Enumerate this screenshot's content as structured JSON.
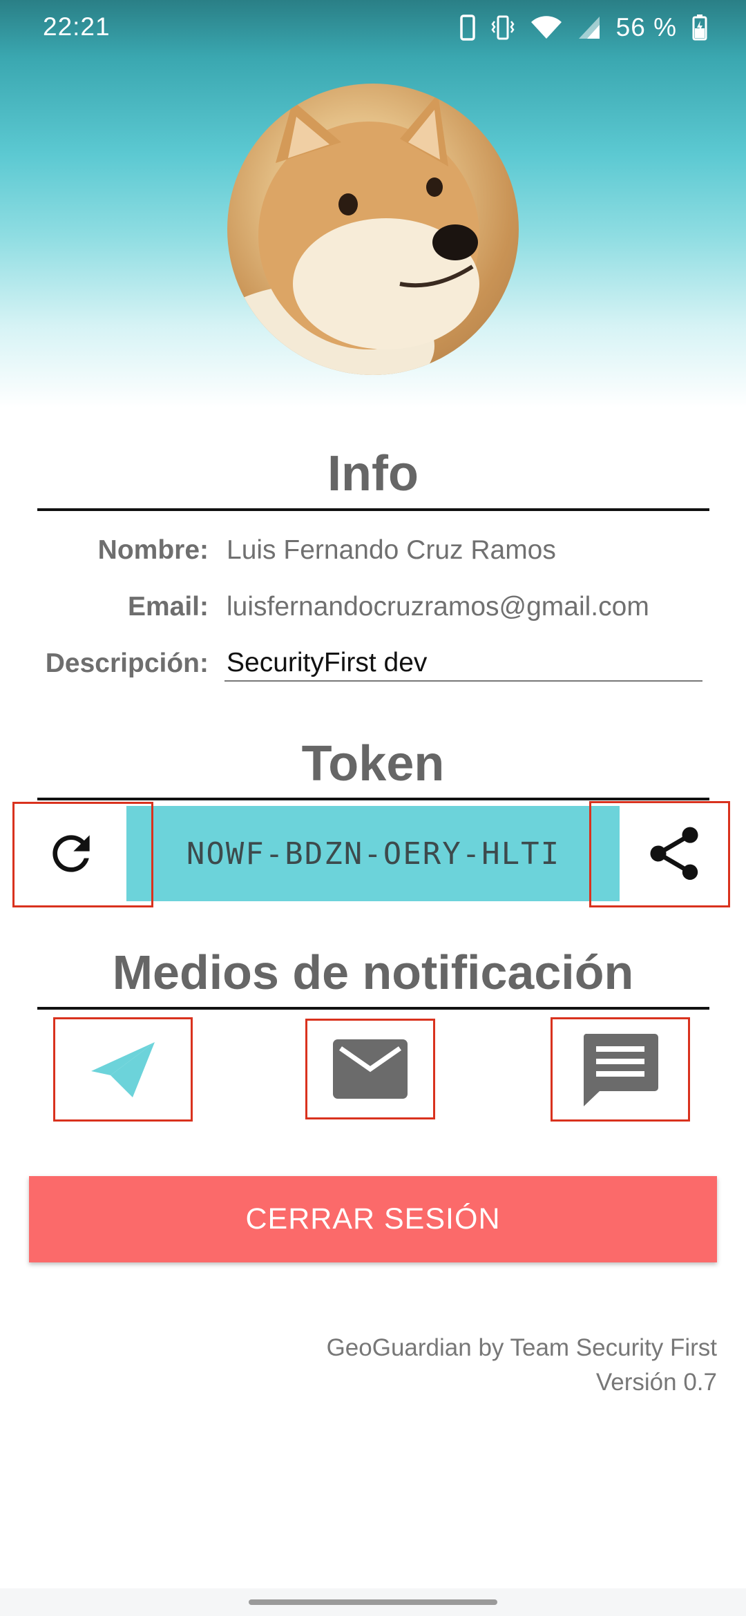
{
  "status_bar": {
    "time": "22:21",
    "battery_text": "56 %"
  },
  "profile": {
    "avatar_icon": "shiba-dog-avatar"
  },
  "info": {
    "title": "Info",
    "name_label": "Nombre:",
    "name_value": "Luis Fernando Cruz Ramos",
    "email_label": "Email:",
    "email_value": "luisfernandocruzramos@gmail.com",
    "description_label": "Descripción:",
    "description_value": "SecurityFirst dev"
  },
  "token": {
    "title": "Token",
    "value": "NOWF-BDZN-OERY-HLTI",
    "refresh_icon": "refresh-icon",
    "share_icon": "share-icon"
  },
  "notifications": {
    "title": "Medios de notificación",
    "channels": [
      {
        "icon": "telegram-icon",
        "color": "#6cd3da"
      },
      {
        "icon": "email-icon",
        "color": "#6b6b6b"
      },
      {
        "icon": "sms-icon",
        "color": "#6b6b6b"
      }
    ]
  },
  "logout_label": "CERRAR SESIÓN",
  "footer": {
    "credit": "GeoGuardian by Team Security First",
    "version": "Versión 0.7"
  },
  "colors": {
    "accent": "#6cd3da",
    "logout": "#fb6a6a",
    "highlight": "#d9321e"
  }
}
